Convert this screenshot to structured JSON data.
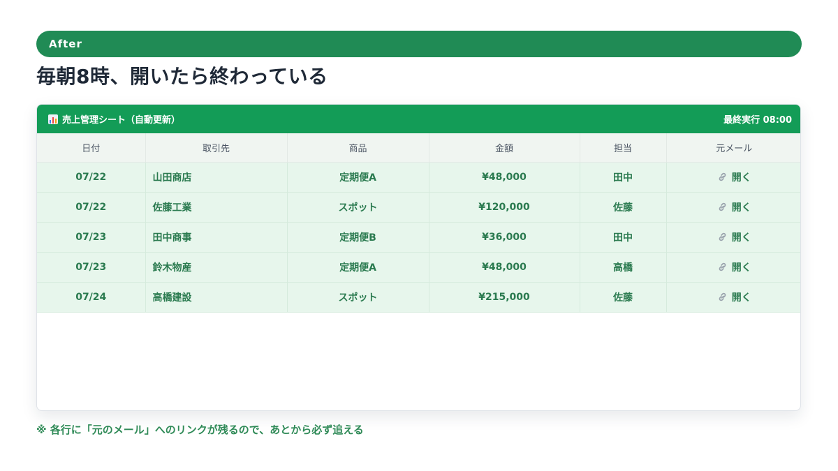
{
  "badge": "After",
  "headline": "毎朝8時、開いたら終わっている",
  "sheet": {
    "title": "売上管理シート（自動更新）",
    "last_run": "最終実行 08:00",
    "icon": "bar-chart-icon",
    "columns": [
      "日付",
      "取引先",
      "商品",
      "金額",
      "担当",
      "元メール"
    ],
    "rows": [
      {
        "date": "07/22",
        "client": "山田商店",
        "product": "定期便A",
        "amount": "¥48,000",
        "owner": "田中",
        "link": "開く"
      },
      {
        "date": "07/22",
        "client": "佐藤工業",
        "product": "スポット",
        "amount": "¥120,000",
        "owner": "佐藤",
        "link": "開く"
      },
      {
        "date": "07/23",
        "client": "田中商事",
        "product": "定期便B",
        "amount": "¥36,000",
        "owner": "田中",
        "link": "開く"
      },
      {
        "date": "07/23",
        "client": "鈴木物産",
        "product": "定期便A",
        "amount": "¥48,000",
        "owner": "高橋",
        "link": "開く"
      },
      {
        "date": "07/24",
        "client": "高橋建設",
        "product": "スポット",
        "amount": "¥215,000",
        "owner": "佐藤",
        "link": "開く"
      }
    ]
  },
  "footnote": "※ 各行に「元のメール」へのリンクが残るので、あとから必ず追える",
  "colors": {
    "accent_green": "#208b55",
    "header_green": "#139c57",
    "row_bg": "#e7f6ec",
    "row_text": "#2a7a4f"
  }
}
